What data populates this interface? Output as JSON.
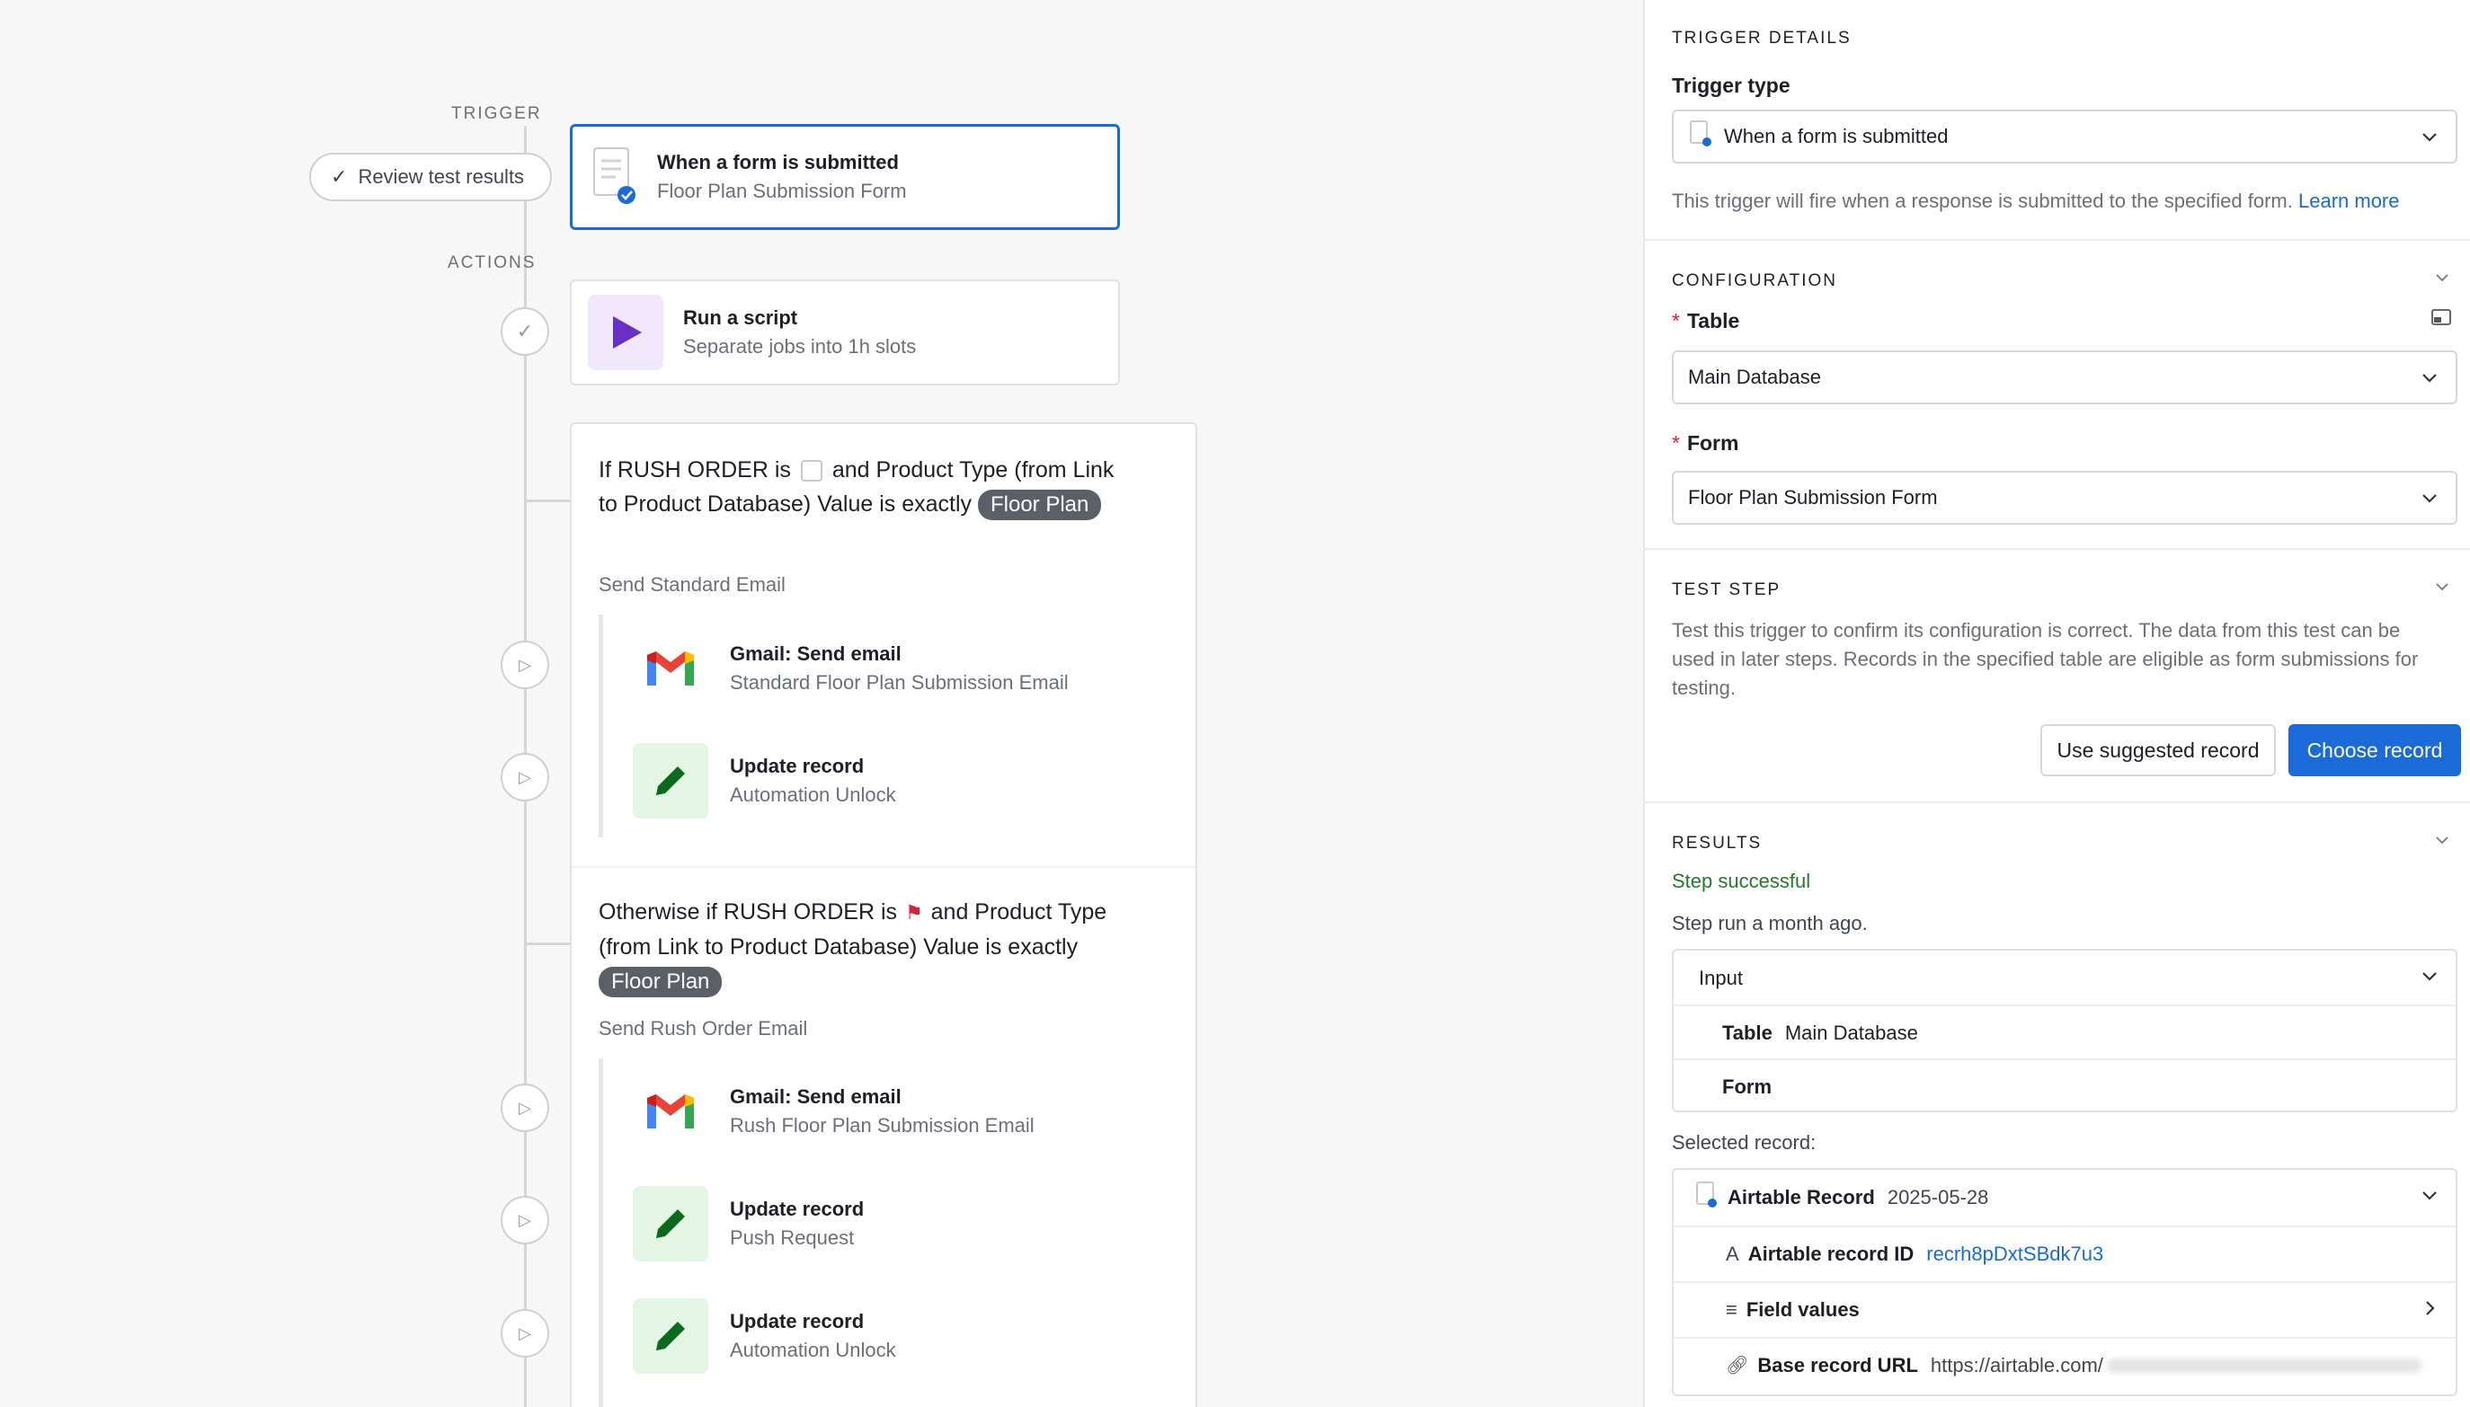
{
  "canvas": {
    "trigger_label": "TRIGGER",
    "actions_label": "ACTIONS",
    "review_button": "Review test results",
    "trigger_card": {
      "title": "When a form is submitted",
      "subtitle": "Floor Plan Submission Form"
    },
    "script_card": {
      "title": "Run a script",
      "subtitle": "Separate jobs into 1h slots"
    },
    "branch1": {
      "cond_part1": "If RUSH ORDER is",
      "cond_part2": "and Product Type (from Link to Product Database) Value is exactly",
      "chip": "Floor Plan",
      "group_label": "Send Standard Email",
      "items": [
        {
          "title": "Gmail: Send email",
          "subtitle": "Standard Floor Plan Submission Email"
        },
        {
          "title": "Update record",
          "subtitle": "Automation Unlock"
        }
      ]
    },
    "branch2": {
      "cond_part1": "Otherwise if RUSH ORDER is",
      "cond_part2": "and Product Type (from Link to Product Database) Value is exactly",
      "chip": "Floor Plan",
      "group_label": "Send Rush Order Email",
      "items": [
        {
          "title": "Gmail: Send email",
          "subtitle": "Rush Floor Plan Submission Email"
        },
        {
          "title": "Update record",
          "subtitle": "Push Request"
        },
        {
          "title": "Update record",
          "subtitle": "Automation Unlock"
        }
      ]
    }
  },
  "panel": {
    "details_title": "TRIGGER DETAILS",
    "trigger_type_label": "Trigger type",
    "trigger_type_value": "When a form is submitted",
    "trigger_desc": "This trigger will fire when a response is submitted to the specified form.",
    "learn_more": "Learn more",
    "config_title": "CONFIGURATION",
    "table_label": "Table",
    "table_value": "Main Database",
    "form_label": "Form",
    "form_value": "Floor Plan Submission Form",
    "test_title": "TEST STEP",
    "test_desc": "Test this trigger to confirm its configuration is correct. The data from this test can be used in later steps. Records in the specified table are eligible as form submissions for testing.",
    "use_suggested": "Use suggested record",
    "choose_record": "Choose record",
    "results_title": "RESULTS",
    "step_status": "Step successful",
    "step_time": "Step run a month ago.",
    "input_label": "Input",
    "input_table_key": "Table",
    "input_table_val": "Main Database",
    "input_form_key": "Form",
    "selected_record_label": "Selected record:",
    "record_name": "Airtable Record",
    "record_date": "2025-05-28",
    "record_id_key": "Airtable record ID",
    "record_id_val": "recrh8pDxtSBdk7u3",
    "field_values_key": "Field values",
    "base_url_key": "Base record URL",
    "base_url_val": "https://airtable.com/"
  },
  "colors": {
    "accent": "#1a6ad7",
    "success": "#237a2a",
    "required": "#d6213b",
    "chip": "#5b5f66"
  }
}
